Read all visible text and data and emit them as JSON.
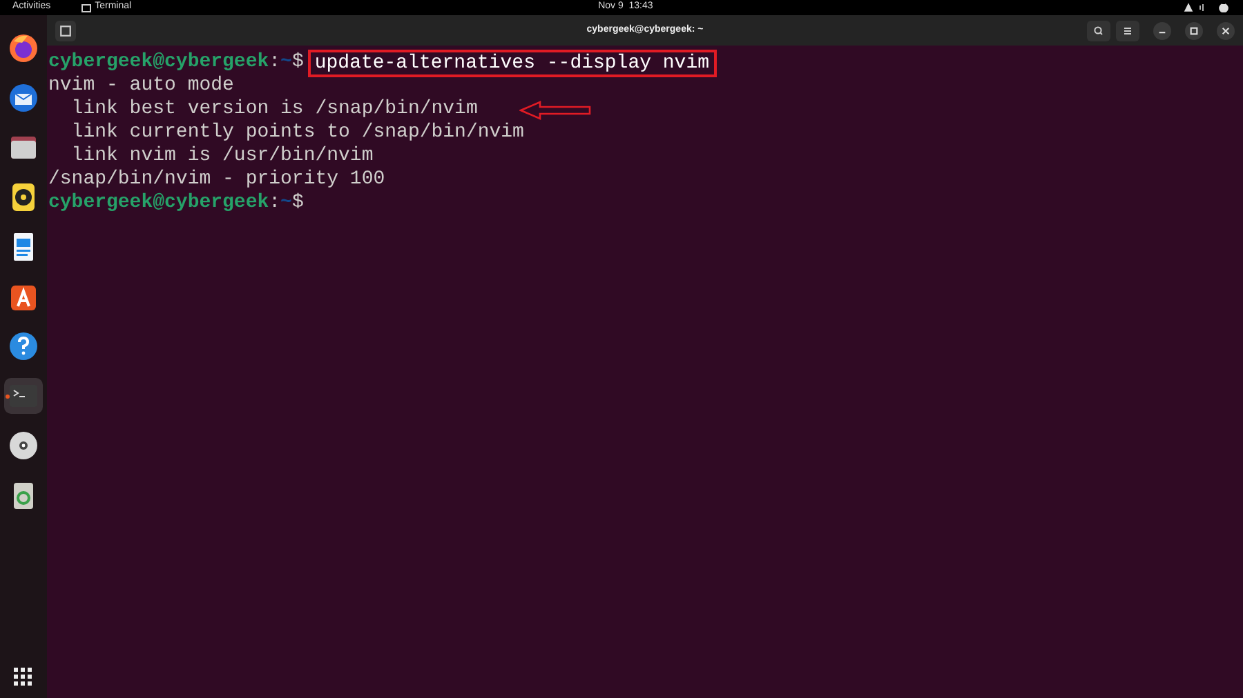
{
  "top_bar": {
    "activities": "Activities",
    "app": "Terminal",
    "clock": "Nov 9  13:43"
  },
  "dock": {
    "items": [
      {
        "kind": "browser",
        "running": false
      },
      {
        "kind": "mail",
        "running": false
      },
      {
        "kind": "files",
        "running": false
      },
      {
        "kind": "music",
        "running": false
      },
      {
        "kind": "document",
        "running": false
      },
      {
        "kind": "store",
        "running": false
      },
      {
        "kind": "help",
        "running": false
      },
      {
        "kind": "terminal",
        "running": true
      },
      {
        "kind": "disc",
        "running": false
      },
      {
        "kind": "trash",
        "running": false
      }
    ]
  },
  "window": {
    "title": "cybergeek@cybergeek: ~"
  },
  "terminal": {
    "lines": [
      {
        "kind": "prompt",
        "user": "cybergeek@cybergeek",
        "separator": ":",
        "path": "~",
        "symbol": "$",
        "command": "update-alternatives --display nvim",
        "highlighted": true
      },
      {
        "kind": "output",
        "text": "nvim - auto mode"
      },
      {
        "kind": "output",
        "text": "  link best version is /snap/bin/nvim",
        "annotated": true
      },
      {
        "kind": "output",
        "text": "  link currently points to /snap/bin/nvim"
      },
      {
        "kind": "output",
        "text": "  link nvim is /usr/bin/nvim"
      },
      {
        "kind": "output",
        "text": "/snap/bin/nvim - priority 100"
      },
      {
        "kind": "prompt",
        "user": "cybergeek@cybergeek",
        "separator": ":",
        "path": "~",
        "symbol": "$"
      }
    ]
  }
}
